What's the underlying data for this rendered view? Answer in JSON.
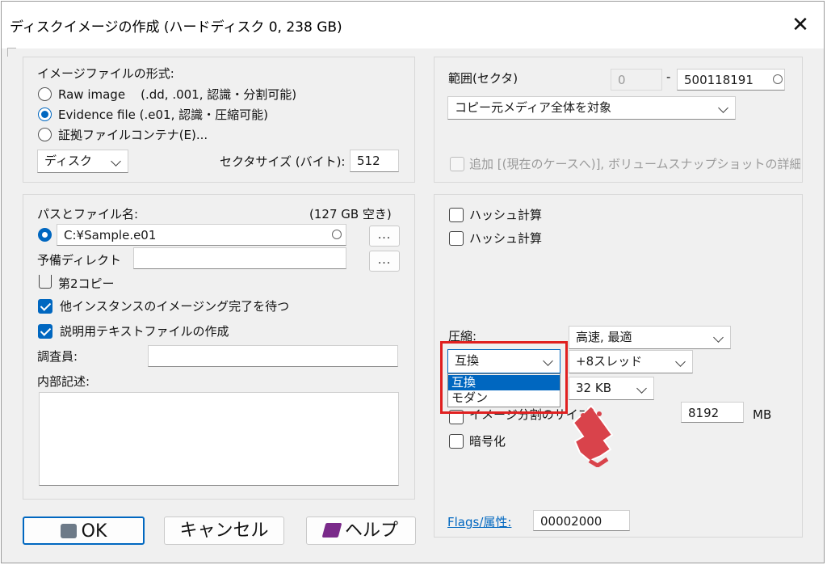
{
  "window": {
    "title": "ディスクイメージの作成 (ハードディスク 0, 238 GB)"
  },
  "format_group": {
    "label": "イメージファイルの形式:",
    "options": [
      {
        "label": "Raw image    (.dd, .001, 認識・分割可能)",
        "selected": false
      },
      {
        "label": "Evidence file (.e01, 認識・圧縮可能)",
        "selected": true
      },
      {
        "label": "証拠ファイルコンテナ(E)...",
        "selected": false
      }
    ],
    "disk_select": "ディスク",
    "sector_size_label": "セクタサイズ (バイト):",
    "sector_size_value": "512"
  },
  "range_group": {
    "label": "範囲(セクタ)",
    "start_value": "0",
    "separator": "-",
    "end_value": "500118191",
    "target_select": "コピー元メディア全体を対象",
    "append_label": "追加 [(現在のケースへ)], ボリュームスナップショットの詳細"
  },
  "path_group": {
    "label": "パスとファイル名:",
    "free_space": "(127 GB 空き)",
    "path_value": "C:¥Sample.e01",
    "browse_label": "...",
    "backup_dir_label": "予備ディレクト",
    "backup_dir_value": "",
    "second_copy_label": "第2コピー",
    "wait_label": "他インスタンスのイメージング完了を待つ",
    "textfile_label": "説明用テキストファイルの作成",
    "examiner_label": "調査員:",
    "examiner_value": "",
    "description_label": "内部記述:",
    "description_value": ""
  },
  "options_group": {
    "hash1_label": "ハッシュ計算",
    "hash2_label": "ハッシュ計算",
    "compression_label": "圧縮:",
    "compression_select": "高速, 最適",
    "compat_select": "互換",
    "compat_options": [
      "互換",
      "モダン"
    ],
    "threads_select": "+8スレッド",
    "chunk_select": "32 KB",
    "split_label": "イメージ分割のサイズ",
    "split_value": "8192",
    "split_unit": "MB",
    "encrypt_label": "暗号化",
    "flags_label": "Flags/属性:",
    "flags_value": "00002000"
  },
  "buttons": {
    "ok": "OK",
    "cancel": "キャンセル",
    "help": "ヘルプ"
  },
  "colors": {
    "accent": "#0067c0",
    "highlight_box": "#e02020",
    "pointer": "#d9434b"
  }
}
